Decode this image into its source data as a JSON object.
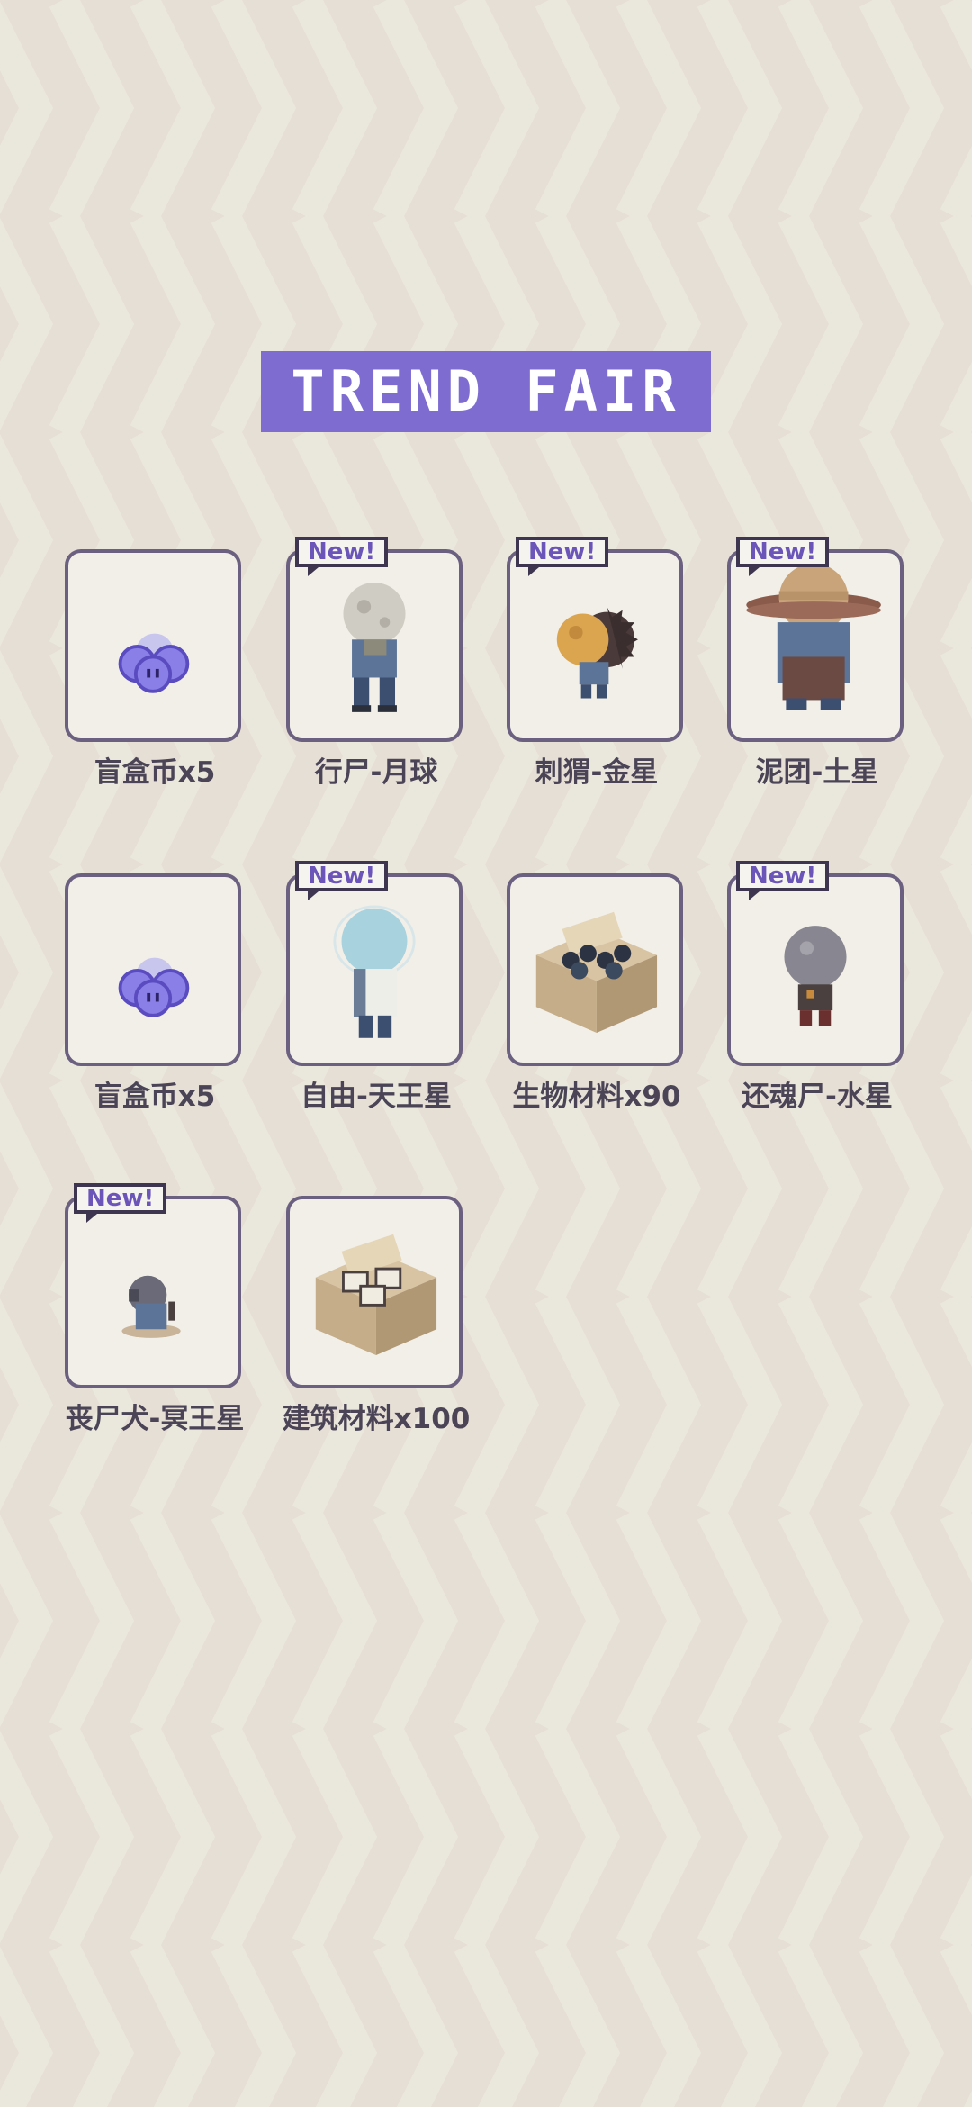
{
  "title": "TREND FAIR",
  "colors": {
    "banner": "#7e6cd1",
    "card_border": "#6c6080",
    "card_bg": "#f2efe8",
    "new_text": "#6b55b8",
    "label_text": "#4a4456"
  },
  "items": [
    {
      "label": "盲盒币x5",
      "icon": "coin-icon",
      "is_new": false,
      "new_label": ""
    },
    {
      "label": "行尸-月球",
      "icon": "zombie-moon-icon",
      "is_new": true,
      "new_label": "New!"
    },
    {
      "label": "刺猬-金星",
      "icon": "hedgehog-venus-icon",
      "is_new": true,
      "new_label": "New!"
    },
    {
      "label": "泥团-土星",
      "icon": "mud-saturn-icon",
      "is_new": true,
      "new_label": "New!"
    },
    {
      "label": "盲盒币x5",
      "icon": "coin-icon",
      "is_new": false,
      "new_label": ""
    },
    {
      "label": "自由-天王星",
      "icon": "freedom-uranus-icon",
      "is_new": true,
      "new_label": "New!"
    },
    {
      "label": "生物材料x90",
      "icon": "bio-material-box-icon",
      "is_new": false,
      "new_label": ""
    },
    {
      "label": "还魂尸-水星",
      "icon": "revenant-mercury-icon",
      "is_new": true,
      "new_label": "New!"
    },
    {
      "label": "丧尸犬-冥王星",
      "icon": "zombie-dog-pluto-icon",
      "is_new": true,
      "new_label": "New!"
    },
    {
      "label": "建筑材料x100",
      "icon": "building-material-box-icon",
      "is_new": false,
      "new_label": ""
    }
  ]
}
